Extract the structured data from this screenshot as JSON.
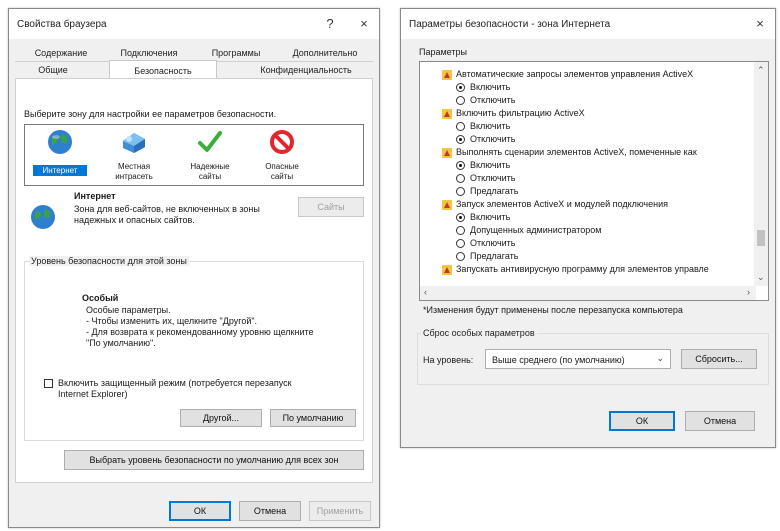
{
  "browser_props": {
    "title": "Свойства браузера",
    "help": "?",
    "close": "×",
    "tabs_row1": [
      "Содержание",
      "Подключения",
      "Программы",
      "Дополнительно"
    ],
    "tabs_row2": [
      "Общие",
      "Безопасность",
      "Конфиденциальность"
    ],
    "zone_prompt": "Выберите зону для настройки ее параметров безопасности.",
    "zones": [
      {
        "label": "Интернет",
        "icon": "globe-icon"
      },
      {
        "label": "Местная\nинтрасеть",
        "icon": "intranet-icon"
      },
      {
        "label": "Надежные\nсайты",
        "icon": "checkmark-icon"
      },
      {
        "label": "Опасные\nсайты",
        "icon": "blocked-icon"
      }
    ],
    "zone_title": "Интернет",
    "zone_desc": "Зона для веб-сайтов, не включенных в зоны\nнадежных и опасных сайтов.",
    "sites_button": "Сайты",
    "level_group": "Уровень безопасности для этой зоны",
    "level_name": "Особый",
    "level_lines": "Особые параметры.\n- Чтобы изменить их, щелкните \"Другой\".\n- Для возврата к рекомендованному уровню щелкните\n\"По умолчанию\".",
    "protected_mode": "Включить защищенный режим (потребуется перезапуск\nInternet Explorer)",
    "custom_button": "Другой...",
    "default_button": "По умолчанию",
    "all_zones_button": "Выбрать уровень безопасности по умолчанию для всех зон",
    "ok": "ОК",
    "cancel": "Отмена",
    "apply": "Применить"
  },
  "security_settings": {
    "title": "Параметры безопасности - зона Интернета",
    "close": "×",
    "params_label": "Параметры",
    "items": [
      {
        "kind": "header",
        "text": "Автоматические запросы элементов управления ActiveX"
      },
      {
        "kind": "radio",
        "text": "Включить",
        "checked": true
      },
      {
        "kind": "radio",
        "text": "Отключить",
        "checked": false
      },
      {
        "kind": "header",
        "text": "Включить фильтрацию ActiveX"
      },
      {
        "kind": "radio",
        "text": "Включить",
        "checked": false
      },
      {
        "kind": "radio",
        "text": "Отключить",
        "checked": true
      },
      {
        "kind": "header",
        "text": "Выполнять сценарии элементов ActiveX, помеченные как"
      },
      {
        "kind": "radio",
        "text": "Включить",
        "checked": true
      },
      {
        "kind": "radio",
        "text": "Отключить",
        "checked": false
      },
      {
        "kind": "radio",
        "text": "Предлагать",
        "checked": false
      },
      {
        "kind": "header",
        "text": "Запуск элементов ActiveX и модулей подключения"
      },
      {
        "kind": "radio",
        "text": "Включить",
        "checked": true
      },
      {
        "kind": "radio",
        "text": "Допущенных администратором",
        "checked": false
      },
      {
        "kind": "radio",
        "text": "Отключить",
        "checked": false
      },
      {
        "kind": "radio",
        "text": "Предлагать",
        "checked": false
      },
      {
        "kind": "header",
        "text": "Запускать антивирусную программу для элементов управле"
      }
    ],
    "note": "*Изменения будут применены после перезапуска компьютера",
    "reset_group": "Сброс особых параметров",
    "reset_label": "На уровень:",
    "reset_value": "Выше среднего (по умолчанию)",
    "reset_button": "Сбросить...",
    "ok": "ОК",
    "cancel": "Отмена"
  }
}
